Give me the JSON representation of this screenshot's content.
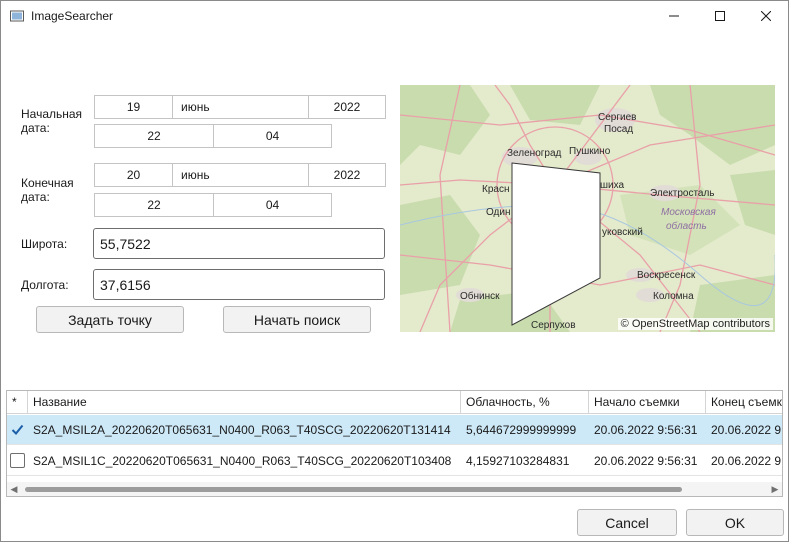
{
  "window": {
    "title": "ImageSearcher"
  },
  "form": {
    "start_label": "Начальная дата:",
    "start_day": "19",
    "start_month": "июнь",
    "start_year": "2022",
    "start_hour": "22",
    "start_minute": "04",
    "end_label": "Конечная дата:",
    "end_day": "20",
    "end_month": "июнь",
    "end_year": "2022",
    "end_hour": "22",
    "end_minute": "04",
    "lat_label": "Широта:",
    "lat_value": "55,7522",
    "lon_label": "Долгота:",
    "lon_value": "37,6156",
    "set_point_button": "Задать точку",
    "search_button": "Начать поиск"
  },
  "map": {
    "credit": "© OpenStreetMap contributors",
    "places": [
      "Сергиев",
      "Посад",
      "Зеленоград",
      "Пушкино",
      "Красн",
      "шиха",
      "Электросталь",
      "Один",
      "Московская",
      "область",
      "уковский",
      "Воскресенск",
      "Обнинск",
      "Коломна",
      "Серпухов"
    ],
    "colors": {
      "land": "#e4eacc",
      "forest": "#c9dcae",
      "urban": "#e2dcd6",
      "road": "#e9a0a8",
      "region_label": "#8e6fa3"
    }
  },
  "grid": {
    "headers": [
      "*",
      "Название",
      "Облачность, %",
      "Начало съемки",
      "Конец съемк"
    ],
    "rows": [
      {
        "checked": true,
        "name": "S2A_MSIL2A_20220620T065631_N0400_R063_T40SCG_20220620T131414",
        "cloud": "5,644672999999999",
        "start": "20.06.2022 9:56:31",
        "end": "20.06.2022 9"
      },
      {
        "checked": false,
        "name": "S2A_MSIL1C_20220620T065631_N0400_R063_T40SCG_20220620T103408",
        "cloud": "4,15927103284831",
        "start": "20.06.2022 9:56:31",
        "end": "20.06.2022 9"
      }
    ],
    "selected_color": "#cde8f7"
  },
  "footer": {
    "cancel": "Cancel",
    "ok": "OK"
  }
}
